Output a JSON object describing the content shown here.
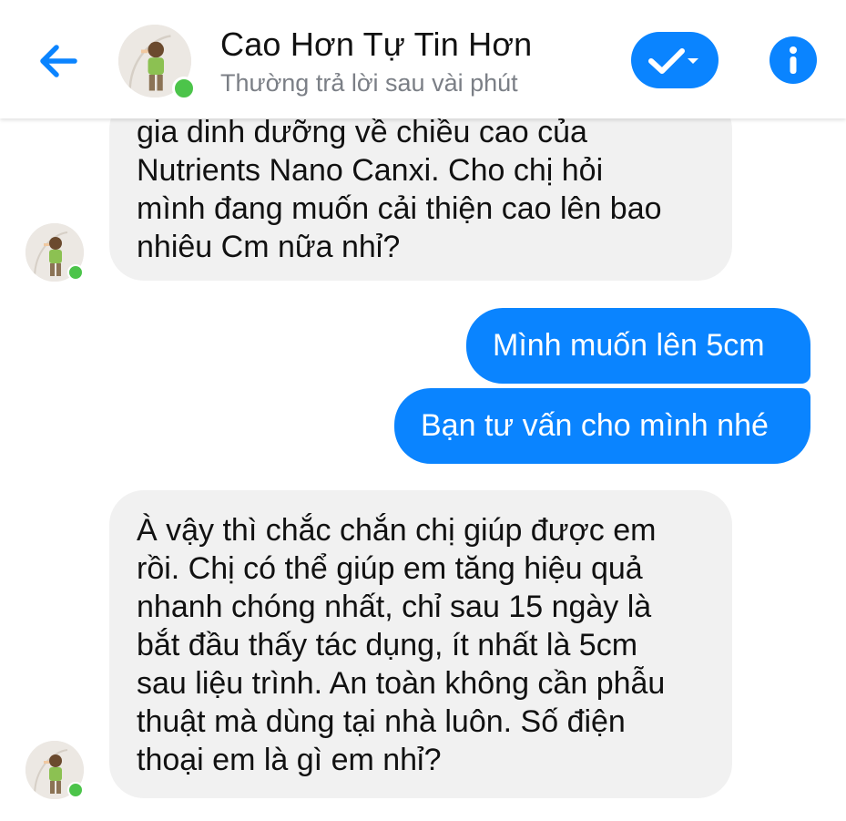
{
  "header": {
    "title": "Cao Hơn Tự Tin Hơn",
    "status": "Thường trả lời sau vài phút",
    "back_icon": "arrow-left-icon",
    "check_icon": "check-dropdown-icon",
    "info_icon": "info-icon",
    "accent_color": "#0a84ff",
    "online_color": "#4cc44a"
  },
  "messages": [
    {
      "from": "page",
      "lines": [
        "gia dinh dưỡng về chiều cao của",
        "Nutrients Nano Canxi. Cho chị hỏi",
        "mình đang muốn cải thiện cao lên bao",
        "nhiêu Cm nữa nhỉ?"
      ]
    },
    {
      "from": "user",
      "text": "Mình muốn lên 5cm"
    },
    {
      "from": "user",
      "text": "Bạn tư vấn cho mình nhé"
    },
    {
      "from": "page",
      "lines": [
        "À vậy thì chắc chắn chị giúp được em",
        "rồi. Chị có thể giúp em tăng hiệu quả",
        "nhanh chóng nhất, chỉ sau 15 ngày là",
        "bắt đầu thấy tác dụng, ít nhất là 5cm",
        "sau liệu trình. An toàn không cần phẫu",
        "thuật mà dùng tại nhà luôn. Số điện",
        "thoại em là gì em nhỉ?"
      ]
    }
  ]
}
